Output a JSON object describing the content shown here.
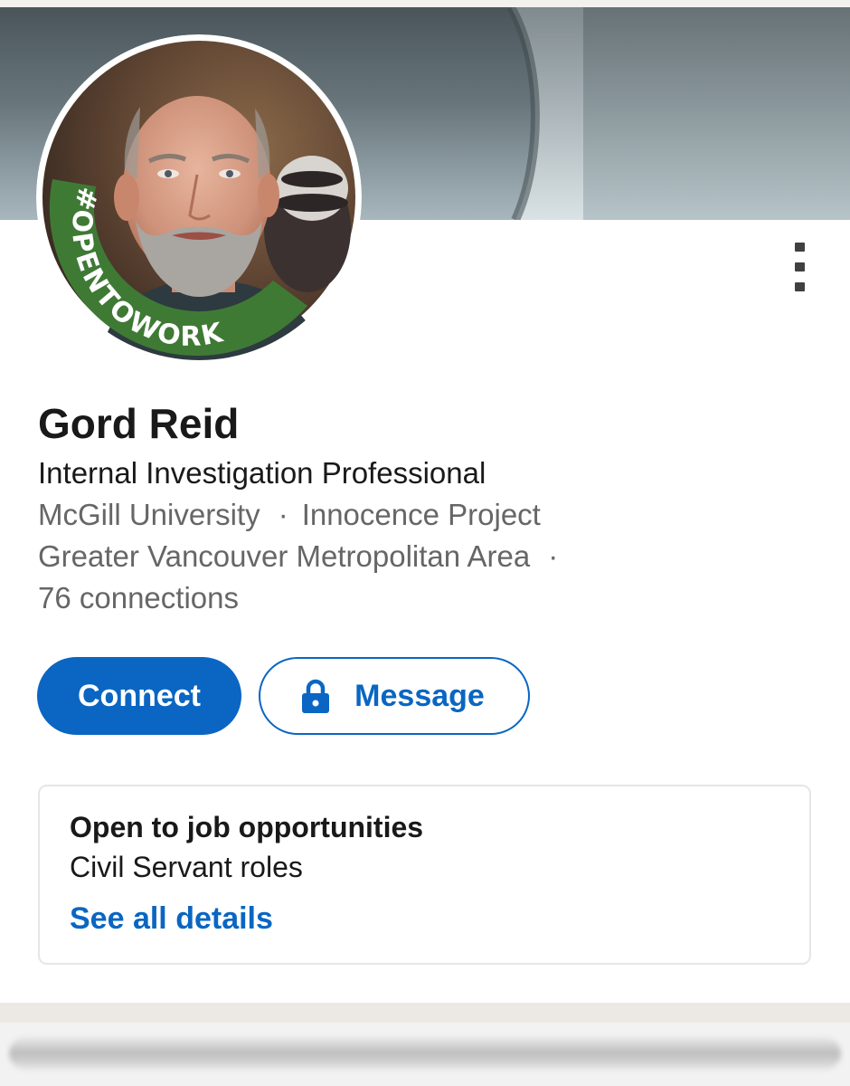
{
  "profile": {
    "name": "Gord Reid",
    "headline": "Internal Investigation Professional",
    "education": "McGill University",
    "separator": "·",
    "organization": "Innocence Project",
    "location": "Greater Vancouver Metropolitan Area",
    "connections": "76 connections",
    "photo_badge": "#OPENTOWORK"
  },
  "actions": {
    "connect_label": "Connect",
    "message_label": "Message",
    "message_icon": "lock-icon",
    "more_icon": "more-vertical-icon"
  },
  "open_to_work": {
    "title": "Open to job opportunities",
    "roles": "Civil Servant roles",
    "link": "See all details"
  },
  "colors": {
    "brand_blue": "#0a66c2",
    "badge_green": "#3f7a35",
    "text_primary": "#191919",
    "text_secondary": "#666666"
  }
}
